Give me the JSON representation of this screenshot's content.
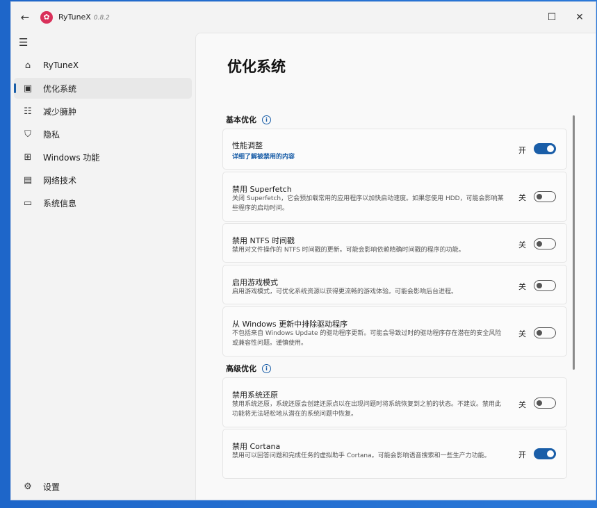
{
  "app": {
    "title": "RyTuneX",
    "version": "0.8.2"
  },
  "window_controls": {
    "maximize": "☐",
    "close": "✕"
  },
  "nav": {
    "items": [
      {
        "label": "RyTuneX",
        "icon": "⌂",
        "icon_name": "home-icon"
      },
      {
        "label": "优化系统",
        "icon": "▣",
        "icon_name": "optimize-icon"
      },
      {
        "label": "减少臃肿",
        "icon": "☷",
        "icon_name": "debloat-icon"
      },
      {
        "label": "隐私",
        "icon": "⛉",
        "icon_name": "shield-icon"
      },
      {
        "label": "Windows 功能",
        "icon": "⊞",
        "icon_name": "windows-features-icon"
      },
      {
        "label": "网络技术",
        "icon": "▤",
        "icon_name": "network-icon"
      },
      {
        "label": "系统信息",
        "icon": "▭",
        "icon_name": "system-info-icon"
      }
    ],
    "settings_label": "设置"
  },
  "page": {
    "title": "优化系统",
    "basic_section": "基本优化",
    "advanced_section": "高级优化"
  },
  "cards": [
    {
      "title": "性能调整",
      "link": "详细了解被禁用的内容",
      "state": "开",
      "on": true
    },
    {
      "title": "禁用 Superfetch",
      "desc": "关闭 Superfetch，它会预加载常用的应用程序以加快启动速度。如果您使用 HDD，可能会影响某些程序的启动时间。",
      "state": "关",
      "on": false
    },
    {
      "title": "禁用 NTFS 时间戳",
      "desc": "禁用对文件操作的 NTFS 时间戳的更新。可能会影响依赖精确时间戳的程序的功能。",
      "state": "关",
      "on": false
    },
    {
      "title": "启用游戏模式",
      "desc": "启用游戏模式，可优化系统资源以获得更流畅的游戏体验。可能会影响后台进程。",
      "state": "关",
      "on": false
    },
    {
      "title": "从 Windows 更新中排除驱动程序",
      "desc": "不包括来自 Windows Update 的驱动程序更新。可能会导致过时的驱动程序存在潜在的安全风险或兼容性问题。谨慎使用。",
      "state": "关",
      "on": false
    },
    {
      "title": "禁用系统还原",
      "desc": "禁用系统还原，系统还原会创建还原点以在出现问题时将系统恢复到之前的状态。不建议。禁用此功能将无法轻松地从潜在的系统问题中恢复。",
      "state": "关",
      "on": false
    },
    {
      "title": "禁用 Cortana",
      "desc": "禁用可以回答问题和完成任务的虚拟助手 Cortana。可能会影响语音搜索和一些生产力功能。",
      "state": "开",
      "on": true
    }
  ]
}
